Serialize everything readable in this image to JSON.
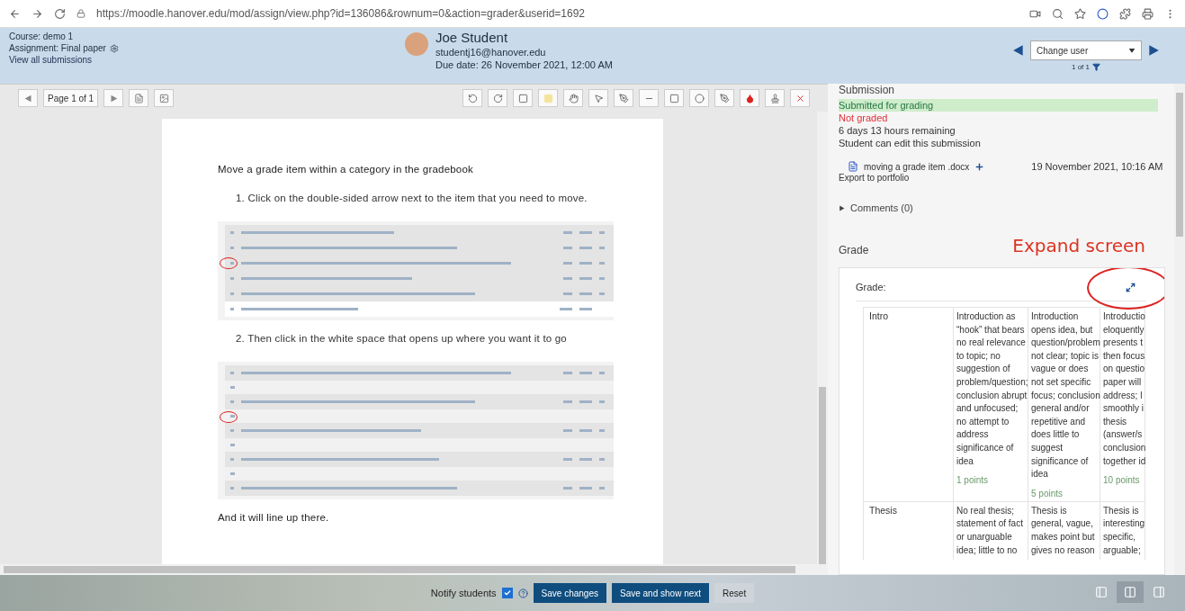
{
  "browser": {
    "url": "https://moodle.hanover.edu/mod/assign/view.php?id=136086&rownum=0&action=grader&userid=1692"
  },
  "header": {
    "course": "Course: demo 1",
    "assignment": "Assignment: Final paper",
    "view_all": "View all submissions",
    "student_name": "Joe Student",
    "student_email": "studentj16@hanover.edu",
    "due_date": "Due date: 26 November 2021, 12:00 AM",
    "user_select": "Change user",
    "pager": "1 of 1"
  },
  "toolbar": {
    "page_label": "Page 1 of 1"
  },
  "document": {
    "blocks": [
      {
        "kind": "heading",
        "text": "Move a grade item within a category in the gradebook"
      },
      {
        "kind": "step",
        "number": "1.",
        "text": "Click on the double-sided arrow next to the item that you need to move."
      },
      {
        "kind": "screenshot",
        "rows": [
          {
            "kind": "item",
            "circled": false
          },
          {
            "kind": "item",
            "circled": false
          },
          {
            "kind": "item",
            "circled": true
          },
          {
            "kind": "item",
            "circled": false
          },
          {
            "kind": "item",
            "circled": false
          },
          {
            "kind": "total",
            "circled": false
          }
        ]
      },
      {
        "kind": "step",
        "number": "2.",
        "text": "Then click in the white space that opens up where you want it to go"
      },
      {
        "kind": "screenshot",
        "rows": [
          {
            "kind": "item",
            "circled": false
          },
          {
            "kind": "gap",
            "circled": false
          },
          {
            "kind": "item",
            "circled": false
          },
          {
            "kind": "gap",
            "circled": true
          },
          {
            "kind": "item",
            "circled": false
          },
          {
            "kind": "gap",
            "circled": false
          },
          {
            "kind": "item",
            "circled": false
          },
          {
            "kind": "gap",
            "circled": false
          },
          {
            "kind": "item",
            "circled": false
          }
        ]
      },
      {
        "kind": "text",
        "text": "And it will line up there."
      }
    ]
  },
  "submission": {
    "title": "Submission",
    "status": "Submitted for grading",
    "grading": "Not graded",
    "remaining": "6 days 13 hours remaining",
    "editable": "Student can edit this submission",
    "file_name": "moving a grade item .docx",
    "file_date": "19 November 2021, 10:16 AM",
    "export": "Export to portfolio",
    "comments": "Comments (0)"
  },
  "grade": {
    "heading": "Grade",
    "annotation": "Expand screen",
    "label": "Grade:",
    "rubric": [
      {
        "criterion": "Intro",
        "levels": [
          {
            "lines": [
              "Introduction as",
              "“hook” that bears",
              "no real relevance",
              "to topic; no",
              "suggestion of",
              "problem/question;",
              "conclusion abrupt",
              "and unfocused;",
              "no attempt to",
              "address",
              "significance of",
              "idea"
            ],
            "points": "1 points"
          },
          {
            "lines": [
              "Introduction",
              "opens idea, but",
              "question/problem",
              "not clear; topic is",
              "vague or does",
              "not set specific",
              "focus; conclusion",
              "general and/or",
              "repetitive and",
              "does little to",
              "suggest",
              "significance of",
              "idea"
            ],
            "points": "5 points"
          },
          {
            "lines": [
              "Introductio",
              "eloquently",
              "presents t",
              "then focus",
              "on questio",
              "paper will",
              "address; l",
              "smoothly i",
              "thesis",
              "(answer/s",
              "conclusion",
              "together id"
            ],
            "points": "10 points"
          }
        ]
      },
      {
        "criterion": "Thesis",
        "levels": [
          {
            "lines": [
              "No real thesis;",
              "statement of fact",
              "or unarguable",
              "idea; little to no"
            ]
          },
          {
            "lines": [
              "Thesis is",
              "general, vague,",
              "makes point but",
              "gives no reason"
            ]
          },
          {
            "lines": [
              "Thesis is",
              "interesting",
              "specific,",
              "arguable;"
            ]
          }
        ]
      }
    ]
  },
  "footer": {
    "notify": "Notify students",
    "notify_checked": true,
    "buttons": [
      "Save changes",
      "Save and show next",
      "Reset"
    ],
    "layouts": [
      {
        "selected": false
      },
      {
        "selected": true
      },
      {
        "selected": false
      }
    ]
  }
}
